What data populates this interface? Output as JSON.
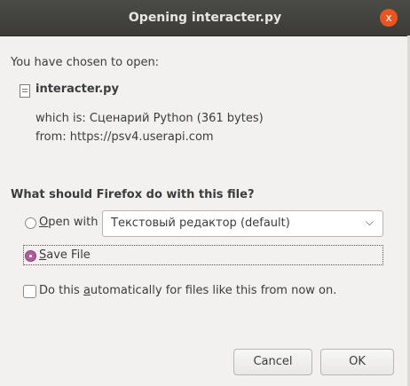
{
  "titlebar": {
    "title": "Opening interacter.py",
    "close_label": "x"
  },
  "intro": {
    "chosen_text": "You have chosen to open:"
  },
  "file": {
    "name": "interacter.py",
    "which_is": "which is: Сценарий Python (361 bytes)",
    "from": "from: https://psv4.userapi.com"
  },
  "question": {
    "text": "What should Firefox do with this file?"
  },
  "options": {
    "open_with": {
      "label_first": "O",
      "label_rest": "pen with",
      "selected": false
    },
    "app_select": {
      "value": "Текстовый редактор (default)"
    },
    "save_file": {
      "label_first": "S",
      "label_rest": "ave File",
      "selected": true
    },
    "auto": {
      "label_before": "Do this ",
      "label_underlined": "a",
      "label_after": "utomatically for files like this from now on.",
      "checked": false
    }
  },
  "buttons": {
    "cancel": "Cancel",
    "ok": "OK"
  }
}
